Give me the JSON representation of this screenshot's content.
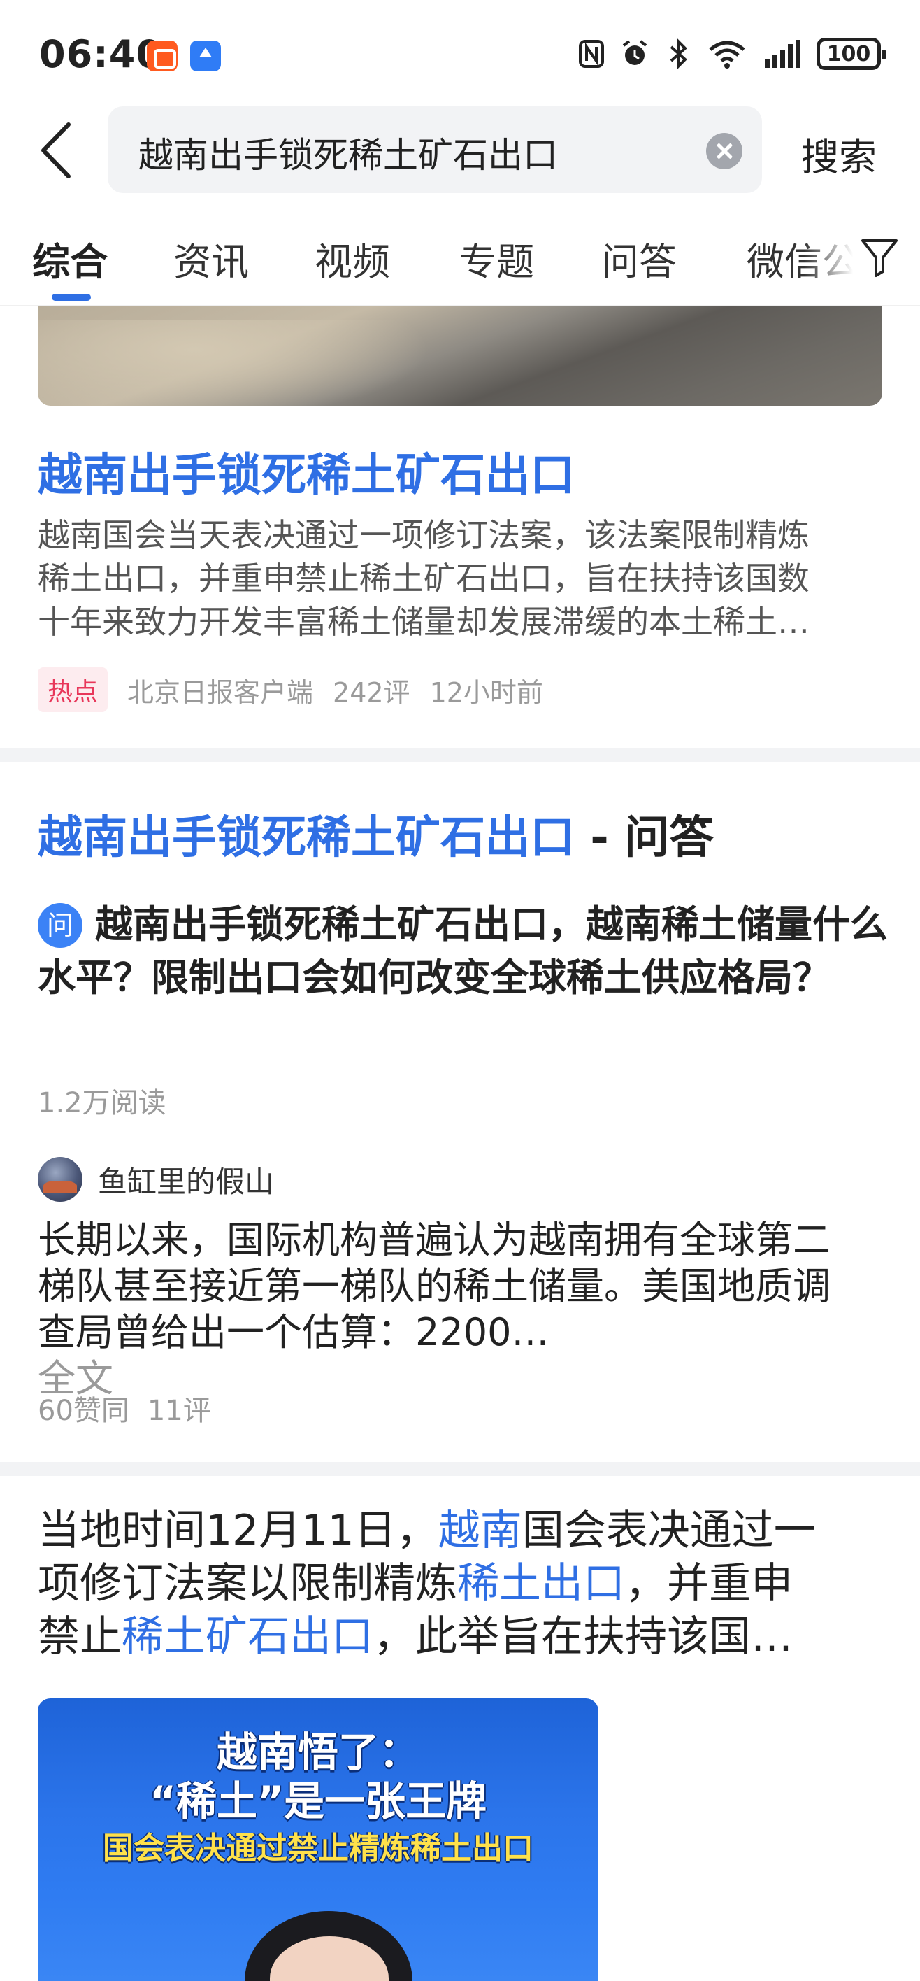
{
  "status_bar": {
    "time": "06:40",
    "battery": "100",
    "icons": [
      "nfc-icon",
      "alarm-icon",
      "bluetooth-icon",
      "wifi-icon",
      "signal-icon",
      "battery-icon"
    ]
  },
  "search": {
    "query": "越南出手锁死稀土矿石出口",
    "button_label": "搜索"
  },
  "tabs": [
    {
      "label": "综合",
      "active": true
    },
    {
      "label": "资讯",
      "active": false
    },
    {
      "label": "视频",
      "active": false
    },
    {
      "label": "专题",
      "active": false
    },
    {
      "label": "问答",
      "active": false
    },
    {
      "label": "微信公",
      "active": false
    }
  ],
  "card1": {
    "title": "越南出手锁死稀土矿石出口",
    "desc_lines": [
      "越南国会当天表决通过一项修订法案，该法案限制精炼",
      "稀土出口，并重申禁止稀土矿石出口，旨在扶持该国数",
      "十年来致力开发丰富稀土储量却发展滞缓的本土稀土…"
    ],
    "tag": "热点",
    "source": "北京日报客户端",
    "comments": "242评",
    "time": "12小时前"
  },
  "card2": {
    "header_highlight": "越南出手锁死稀土矿石出口",
    "header_suffix": " - 问答",
    "q_badge": "问",
    "question": "越南出手锁死稀土矿石出口，越南稀土储量什么水平？限制出口会如何改变全球稀土供应格局？",
    "reads": "1.2万阅读",
    "author": "鱼缸里的假山",
    "answer_lines": [
      "长期以来，国际机构普遍认为越南拥有全球第二",
      "梯队甚至接近第一梯队的稀土储量。美国地质调",
      "查局曾给出一个估算：2200…"
    ],
    "fulltext": "全文",
    "likes": "60赞同",
    "comments": "11评"
  },
  "card3": {
    "line1_a": "当地时间12月11日，",
    "line1_b": "越南",
    "line1_c": "国会表决通过一",
    "line2_a": "项修订法案以限制精炼",
    "line2_b": "稀土出口",
    "line2_c": "，并重申",
    "line3_a": "禁止",
    "line3_b": "稀土矿石出口",
    "line3_c": "，此举旨在扶持该国…",
    "thumb_line1": "越南悟了：",
    "thumb_line2": "“稀土”是一张王牌",
    "thumb_line3": "国会表决通过禁止精炼稀土出口"
  },
  "colors": {
    "accent": "#2f6fe4",
    "hot_tag": "#e8375a",
    "muted": "#9a9a9a"
  }
}
